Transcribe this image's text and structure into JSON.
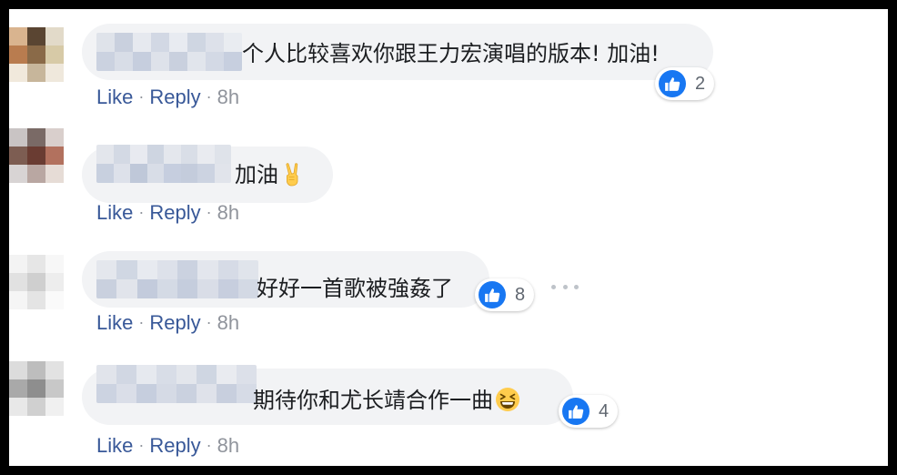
{
  "comments": [
    {
      "text": "个人比较喜欢你跟王力宏演唱的版本! 加油!",
      "actions": {
        "like": "Like",
        "reply": "Reply",
        "time": "8h"
      },
      "reaction": {
        "icon": "like-icon",
        "count": "2"
      }
    },
    {
      "text": "加油",
      "emoji": "victory-hand-icon",
      "actions": {
        "like": "Like",
        "reply": "Reply",
        "time": "8h"
      }
    },
    {
      "text": "好好一首歌被強姦了",
      "actions": {
        "like": "Like",
        "reply": "Reply",
        "time": "8h"
      },
      "reaction": {
        "icon": "like-icon",
        "count": "8"
      }
    },
    {
      "text": "期待你和尤长靖合作一曲",
      "emoji": "grinning-squinting-face-icon",
      "actions": {
        "like": "Like",
        "reply": "Reply",
        "time": "8h"
      },
      "reaction": {
        "icon": "like-icon",
        "count": "4"
      }
    }
  ],
  "colors": {
    "link": "#385898",
    "muted": "#90949c",
    "bubble": "#f2f3f5",
    "like_blue": "#1877f2"
  },
  "separator": "·"
}
